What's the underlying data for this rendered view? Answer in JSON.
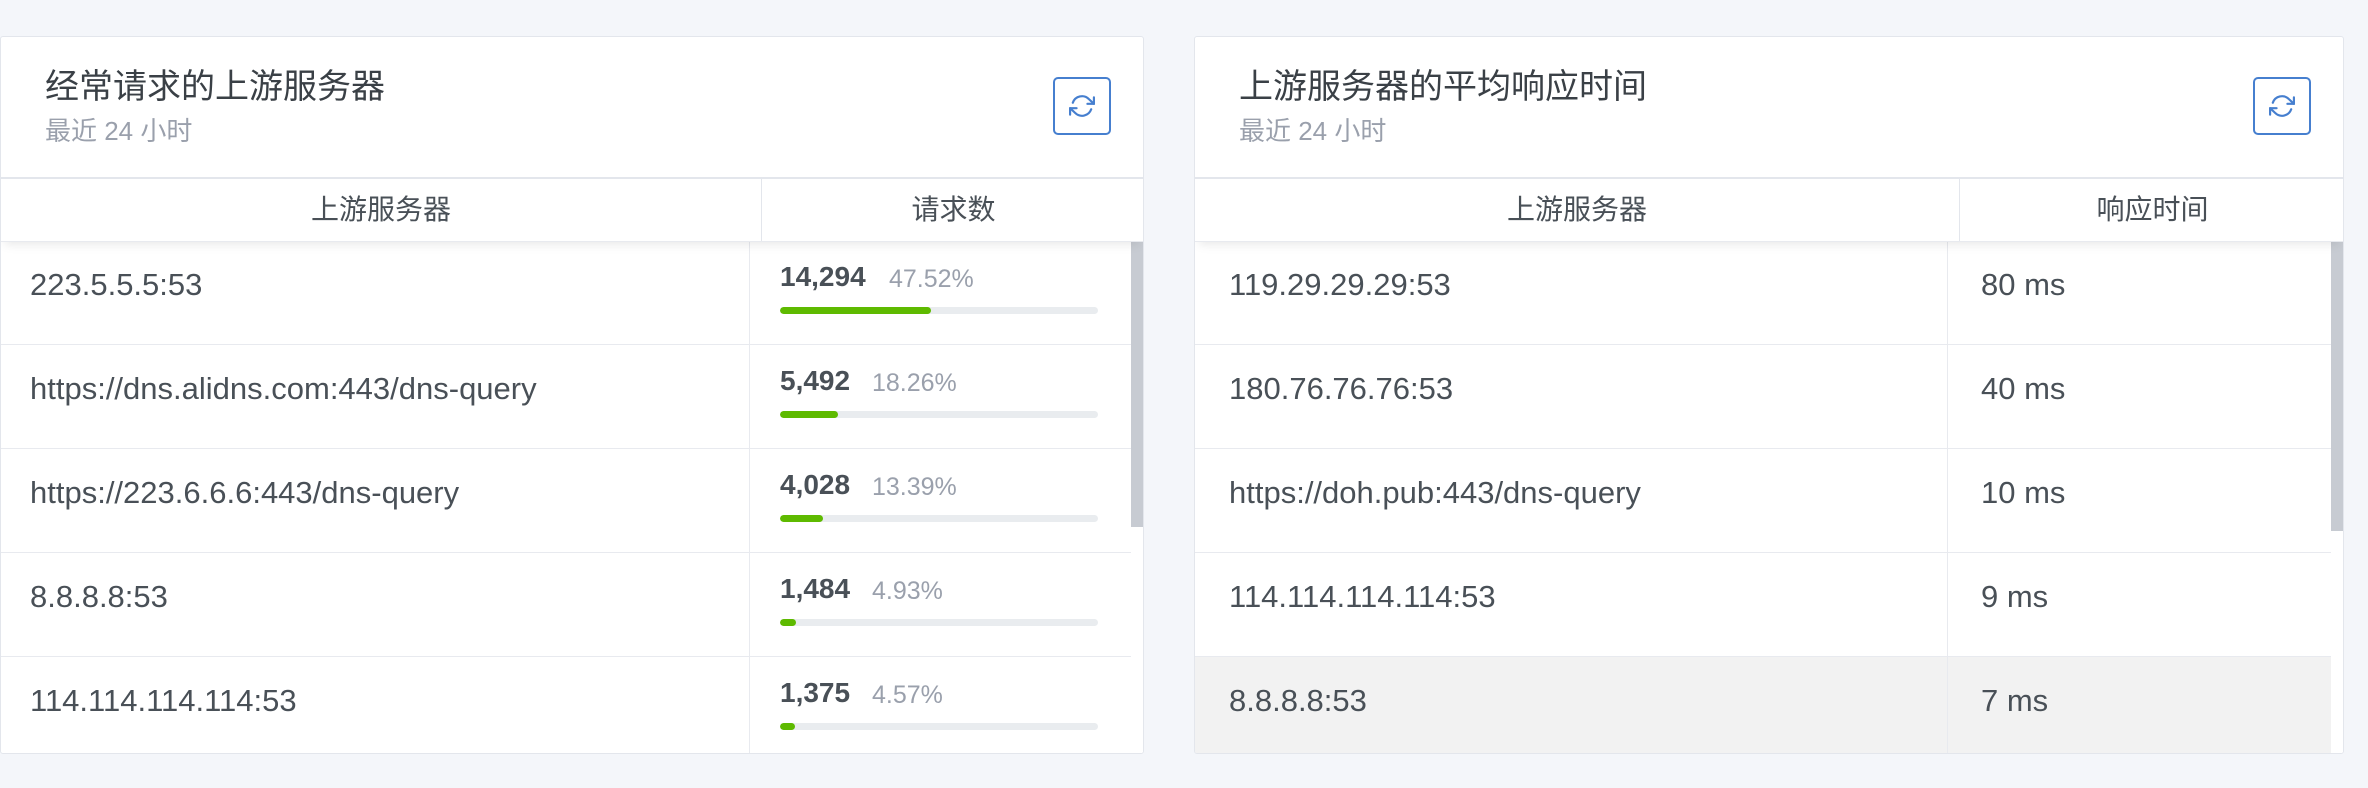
{
  "left_card": {
    "title": "经常请求的上游服务器",
    "subtitle": "最近 24 小时",
    "refresh_icon": "refresh-icon",
    "columns": [
      "上游服务器",
      "请求数"
    ],
    "rows": [
      {
        "server": "223.5.5.5:53",
        "count": "14,294",
        "percent": "47.52%",
        "fraction": 0.4752
      },
      {
        "server": "https://dns.alidns.com:443/dns-query",
        "count": "5,492",
        "percent": "18.26%",
        "fraction": 0.1826
      },
      {
        "server": "https://223.6.6.6:443/dns-query",
        "count": "4,028",
        "percent": "13.39%",
        "fraction": 0.1339
      },
      {
        "server": "8.8.8.8:53",
        "count": "1,484",
        "percent": "4.93%",
        "fraction": 0.0493
      },
      {
        "server": "114.114.114.114:53",
        "count": "1,375",
        "percent": "4.57%",
        "fraction": 0.0457
      }
    ]
  },
  "right_card": {
    "title": "上游服务器的平均响应时间",
    "subtitle": "最近 24 小时",
    "refresh_icon": "refresh-icon",
    "columns": [
      "上游服务器",
      "响应时间"
    ],
    "rows": [
      {
        "server": "119.29.29.29:53",
        "time": "80 ms"
      },
      {
        "server": "180.76.76.76:53",
        "time": "40 ms"
      },
      {
        "server": "https://doh.pub:443/dns-query",
        "time": "10 ms"
      },
      {
        "server": "114.114.114.114:53",
        "time": "9 ms"
      },
      {
        "server": "8.8.8.8:53",
        "time": "7 ms"
      }
    ]
  },
  "colors": {
    "bar_fill": "#5eba00",
    "button_border": "#467fcf"
  }
}
